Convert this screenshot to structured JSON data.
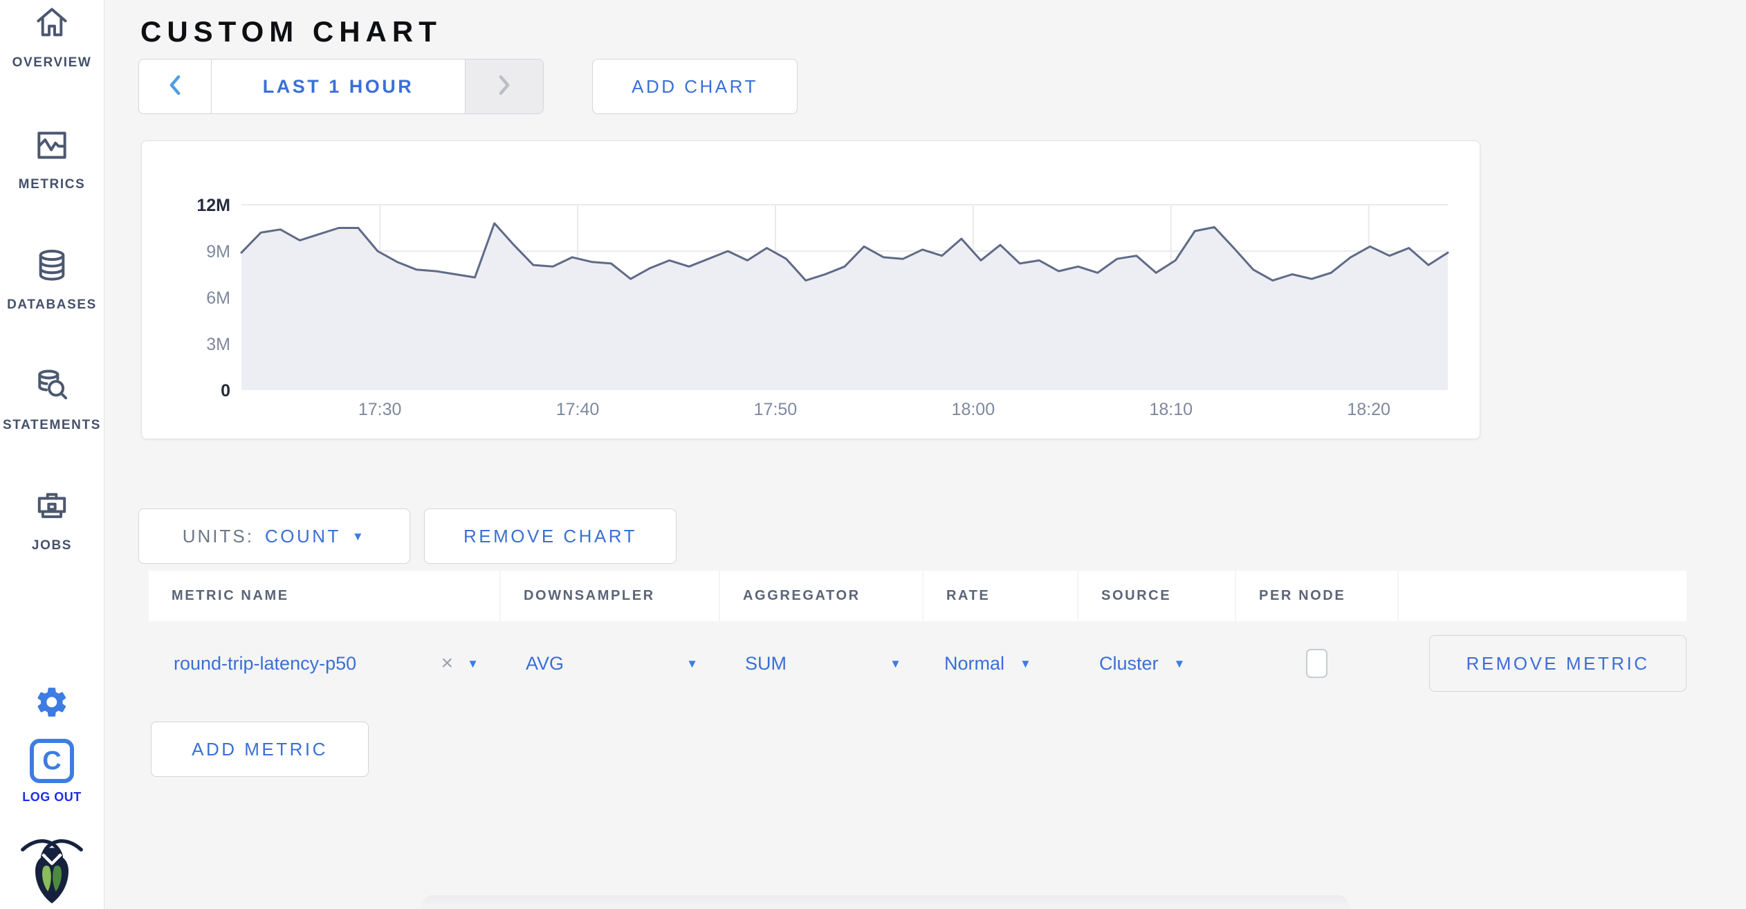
{
  "page": {
    "title": "CUSTOM CHART"
  },
  "sidebar": {
    "items": [
      {
        "label": "OVERVIEW",
        "icon": "home-icon"
      },
      {
        "label": "METRICS",
        "icon": "metrics-icon"
      },
      {
        "label": "DATABASES",
        "icon": "database-icon"
      },
      {
        "label": "STATEMENTS",
        "icon": "statements-icon"
      },
      {
        "label": "JOBS",
        "icon": "briefcase-icon"
      }
    ],
    "logout": {
      "label": "LOG OUT",
      "monogram": "C"
    }
  },
  "toolbar": {
    "time_range_label": "LAST 1 HOUR",
    "add_chart_label": "ADD CHART"
  },
  "chart_controls": {
    "units_label": "UNITS:",
    "units_value": "COUNT",
    "remove_chart_label": "REMOVE CHART",
    "add_metric_label": "ADD METRIC"
  },
  "metric_table": {
    "headers": [
      "METRIC NAME",
      "DOWNSAMPLER",
      "AGGREGATOR",
      "RATE",
      "SOURCE",
      "PER NODE",
      ""
    ],
    "rows": [
      {
        "metric_name": "round-trip-latency-p50",
        "downsampler": "AVG",
        "aggregator": "SUM",
        "rate": "Normal",
        "source": "Cluster",
        "per_node_checked": false,
        "remove_label": "REMOVE METRIC"
      }
    ]
  },
  "icons": {
    "caret_down": "▼",
    "close": "×"
  },
  "colors": {
    "accent_blue": "#3a6fd6",
    "line": "#5f6a87",
    "area_fill": "#edeef3",
    "grid": "#e9eaec",
    "tick": "#7e889c",
    "tick_strong": "#242b3d"
  },
  "chart_data": {
    "type": "area",
    "title": "",
    "series": [
      {
        "name": "round-trip-latency-p50"
      }
    ],
    "x_range": [
      "17:23",
      "18:24"
    ],
    "x_ticks": [
      "17:30",
      "17:40",
      "17:50",
      "18:00",
      "18:10",
      "18:20"
    ],
    "y_ticks": [
      {
        "label": "0",
        "value": 0
      },
      {
        "label": "3M",
        "value": 3
      },
      {
        "label": "6M",
        "value": 6
      },
      {
        "label": "9M",
        "value": 9
      },
      {
        "label": "12M",
        "value": 12
      }
    ],
    "ylim_millions": [
      0,
      12
    ],
    "unit": "count (millions)",
    "values_millions": [
      8.9,
      10.2,
      10.4,
      9.7,
      10.1,
      10.5,
      10.5,
      9.0,
      8.3,
      7.8,
      7.7,
      7.5,
      7.3,
      10.8,
      9.4,
      8.1,
      8.0,
      8.6,
      8.3,
      8.2,
      7.2,
      7.9,
      8.4,
      8.0,
      8.5,
      9.0,
      8.4,
      9.2,
      8.5,
      7.1,
      7.5,
      8.0,
      9.3,
      8.6,
      8.5,
      9.1,
      8.7,
      9.8,
      8.4,
      9.4,
      8.2,
      8.4,
      7.7,
      8.0,
      7.6,
      8.5,
      8.7,
      7.6,
      8.4,
      10.3,
      10.55,
      9.2,
      7.8,
      7.1,
      7.5,
      7.2,
      7.6,
      8.6,
      9.3,
      8.7,
      9.2,
      8.1,
      8.9
    ]
  }
}
